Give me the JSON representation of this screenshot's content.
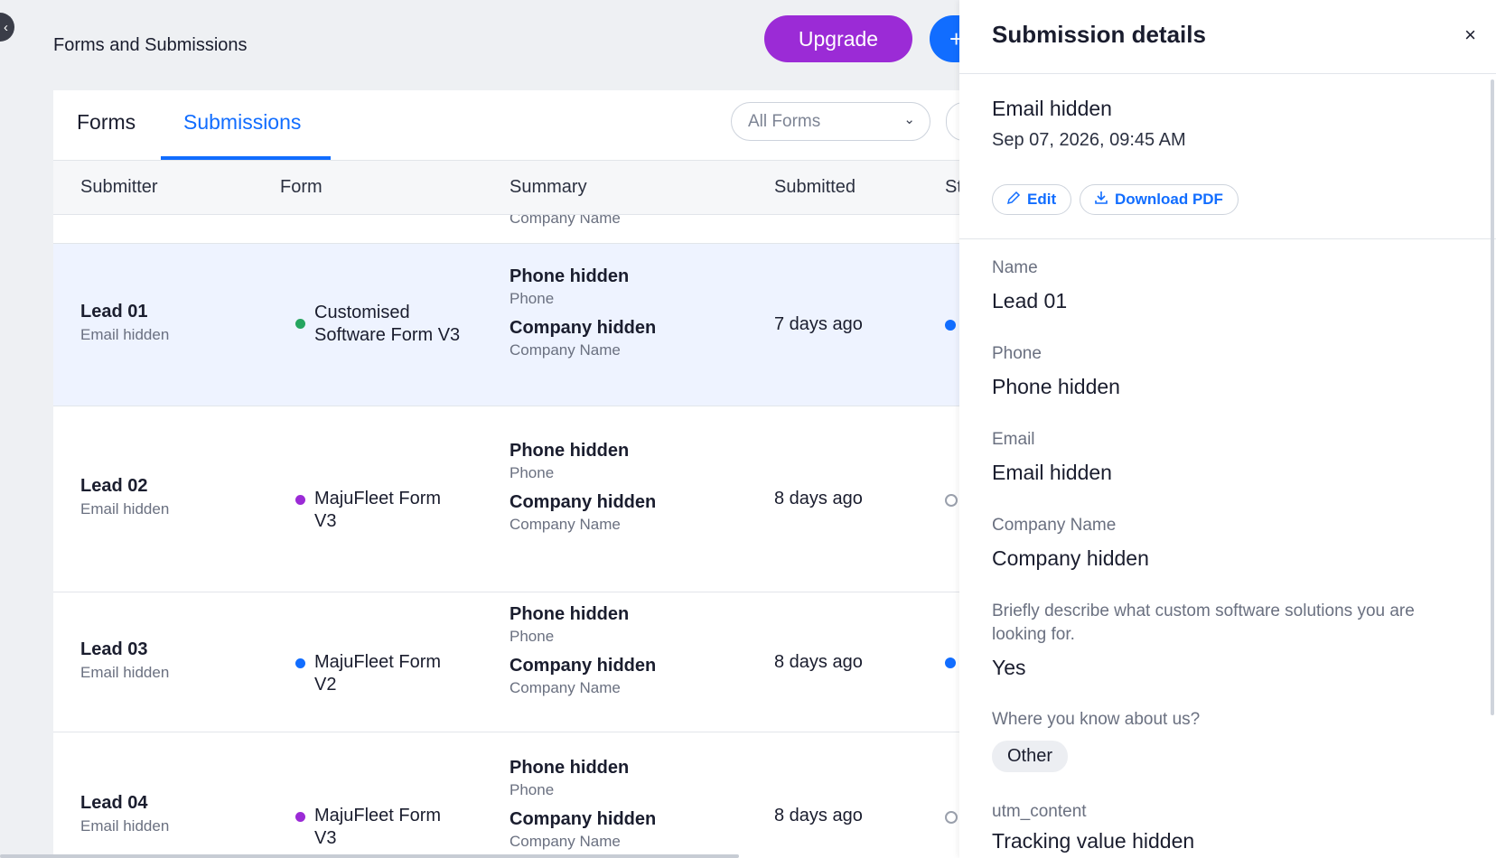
{
  "header": {
    "title": "Forms and Submissions",
    "upgrade_label": "Upgrade",
    "plus_label": "+"
  },
  "tabs": [
    {
      "label": "Forms",
      "active": false
    },
    {
      "label": "Submissions",
      "active": true
    }
  ],
  "filter": {
    "value": "All Forms"
  },
  "table": {
    "columns": [
      "Submitter",
      "Form",
      "Summary",
      "Submitted",
      "St"
    ],
    "partial_row_text": "Company Name",
    "rows": [
      {
        "name": "Lead 01",
        "email": "Email hidden",
        "form": "Customised Software Form V3",
        "form_color": "#25a55f",
        "phone": "Phone hidden",
        "phone_label": "Phone",
        "company": "Company hidden",
        "company_label": "Company Name",
        "submitted": "7 days ago",
        "status": "filled",
        "selected": true
      },
      {
        "name": "Lead 02",
        "email": "Email hidden",
        "form": "MajuFleet Form V3",
        "form_color": "#9b2bd6",
        "phone": "Phone hidden",
        "phone_label": "Phone",
        "company": "Company hidden",
        "company_label": "Company Name",
        "submitted": "8 days ago",
        "status": "empty",
        "selected": false
      },
      {
        "name": "Lead 03",
        "email": "Email hidden",
        "form": "MajuFleet Form V2",
        "form_color": "#116dff",
        "phone": "Phone hidden",
        "phone_label": "Phone",
        "company": "Company hidden",
        "company_label": "Company Name",
        "submitted": "8 days ago",
        "status": "filled",
        "selected": false
      },
      {
        "name": "Lead 04",
        "email": "Email hidden",
        "form": "MajuFleet Form V3",
        "form_color": "#9b2bd6",
        "phone": "Phone hidden",
        "phone_label": "Phone",
        "company": "Company hidden",
        "company_label": "Company Name",
        "submitted": "8 days ago",
        "status": "empty",
        "selected": false
      }
    ]
  },
  "panel": {
    "title": "Submission details",
    "close_label": "×",
    "email": "Email hidden",
    "date": "Sep 07, 2026, 09:45 AM",
    "edit_label": "Edit",
    "pdf_label": "Download PDF",
    "fields": {
      "name_label": "Name",
      "name_value": "Lead 01",
      "phone_label": "Phone",
      "phone_value": "Phone hidden",
      "email_label": "Email",
      "email_value": "Email hidden",
      "company_label": "Company Name",
      "company_value": "Company hidden",
      "describe_label": "Briefly describe what custom software solutions you are looking for.",
      "describe_value": "Yes",
      "know_label": "Where you know about us?",
      "know_value": "Other",
      "utm_label": "utm_content",
      "utm_value": "Tracking value hidden"
    }
  },
  "colors": {
    "accent": "#116dff",
    "upgrade": "#9b2bd6"
  }
}
